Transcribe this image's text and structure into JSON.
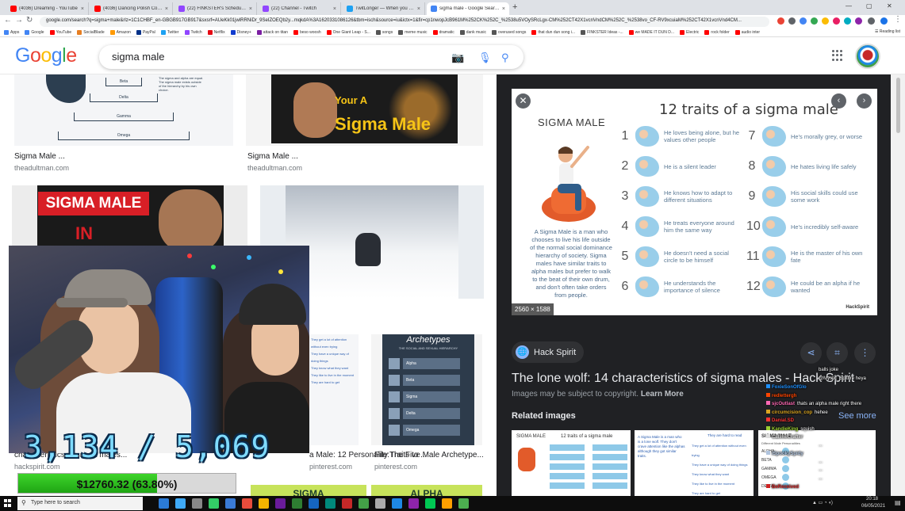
{
  "browser": {
    "tabs": [
      {
        "title": "(4036) Dreaming - YouTube",
        "color": "#ff0000"
      },
      {
        "title": "(4036) Dancing Polish Cow 10 H",
        "color": "#ff0000"
      },
      {
        "title": "(22) FINKSTER's Schedule - Twi",
        "color": "#9146ff"
      },
      {
        "title": "(22) Channel - Twitch",
        "color": "#9146ff"
      },
      {
        "title": "TwitLonger — When you talk to",
        "color": "#1da1f2"
      },
      {
        "title": "sigma male - Google Search",
        "color": "#4285f4"
      }
    ],
    "url": "google.com/search?q=sigma+male&rlz=1C1CHBF_en-GBGB917GB917&sxsrf=AUeKk01jwlRRNiDr_9SeIZOEQb2y...mqkdA%3A1620331086126&tbm=isch&source=iu&ictx=1&fir=cp1nwopJcB961M%252CK%252C_%2538u5VOySRcLgx-CM%252CT42X1vcnVndCM%252C_%2538vo_CF-RV9xcuiaM%252CT42X1vcnVnd4CM..."
  },
  "bookmarks": [
    {
      "label": "Apps",
      "color": "#4285f4"
    },
    {
      "label": "Google",
      "color": "#4285f4"
    },
    {
      "label": "YouTube",
      "color": "#ff0000"
    },
    {
      "label": "SocialBlade",
      "color": "#e67e22"
    },
    {
      "label": "Amazon",
      "color": "#ff9900"
    },
    {
      "label": "PayPal",
      "color": "#003087"
    },
    {
      "label": "Twitter",
      "color": "#1da1f2"
    },
    {
      "label": "Twitch",
      "color": "#9146ff"
    },
    {
      "label": "Netflix",
      "color": "#e50914"
    },
    {
      "label": "Disney+",
      "color": "#113ccf"
    },
    {
      "label": "attack on titan",
      "color": "#7b1fa2"
    },
    {
      "label": "beso woosh",
      "color": "#ff0000"
    },
    {
      "label": "One Giant Leap - S...",
      "color": "#ff0000"
    },
    {
      "label": "songs",
      "color": "#555555"
    },
    {
      "label": "meme music",
      "color": "#555555"
    },
    {
      "label": "dramatic",
      "color": "#ff0000"
    },
    {
      "label": "dank music",
      "color": "#555555"
    },
    {
      "label": "overused songs",
      "color": "#555555"
    },
    {
      "label": "that dun dun song i...",
      "color": "#ff0000"
    },
    {
      "label": "FINKSTER Ideas -...",
      "color": "#555555"
    },
    {
      "label": "we MADE IT DUN D...",
      "color": "#ff0000"
    },
    {
      "label": "Electric",
      "color": "#ff0000"
    },
    {
      "label": "rock folder",
      "color": "#ff0000"
    },
    {
      "label": "audio inter",
      "color": "#ff0000"
    }
  ],
  "reading_list": "Reading list",
  "search": {
    "query": "sigma male"
  },
  "results": [
    {
      "caption": "Sigma Male ...",
      "source": "theadultman.com"
    },
    {
      "caption": "Sigma Male ...",
      "source": "theadultman.com"
    },
    {
      "caption": "characteristics of sigma males...",
      "source": "hackspirit.com"
    },
    {
      "caption": "a Male: 12 Personality Traits to ...",
      "source": "pinterest.com"
    },
    {
      "caption": "File:The Five Male Archetype...",
      "source": "pinterest.com"
    }
  ],
  "thumb_texts": {
    "pyramid": [
      "Beta",
      "Delta",
      "Gamma",
      "Omega"
    ],
    "pyramid_note": "The sigma and alpha are equal. The sigma male exists outside of the hierarchy by his own choice.",
    "your_a": "Your A",
    "sigma_male": "Sigma Male",
    "sigma_male_caps": "SIGMA MALE",
    "in": "IN",
    "archetypes": "Archetypes",
    "archetypes_sub": "THE SOCIAL AND SEXUAL HIERARCHY",
    "arch_rows": [
      "Alpha",
      "Beta",
      "Sigma",
      "Delta",
      "Omega"
    ],
    "bottom": [
      "SIGMA",
      "ALPHA"
    ]
  },
  "preview": {
    "infographic": {
      "title": "12 traits of a sigma male",
      "subtitle": "SIGMA MALE",
      "description": "A Sigma Male is a man who chooses to live his life outside of the normal social dominance hierarchy of society. Sigma males have similar traits to alpha males but prefer to walk to the beat of their own drum, and don't often take orders from people.",
      "dimensions": "2560 × 1588",
      "logo": "HackSpirit",
      "traits": [
        {
          "n": "1",
          "text": "He loves being alone, but he values other people"
        },
        {
          "n": "2",
          "text": "He is a silent leader"
        },
        {
          "n": "3",
          "text": "He knows how to adapt to different situations"
        },
        {
          "n": "4",
          "text": "He treats everyone around him the same way"
        },
        {
          "n": "5",
          "text": "He doesn't need a social circle to be himself"
        },
        {
          "n": "6",
          "text": "He understands the importance of silence"
        },
        {
          "n": "7",
          "text": "He's morally grey, or worse"
        },
        {
          "n": "8",
          "text": "He hates living life safely"
        },
        {
          "n": "9",
          "text": "His social skills could use some work"
        },
        {
          "n": "10",
          "text": "He's incredibly self-aware"
        },
        {
          "n": "11",
          "text": "He is the master of his own fate"
        },
        {
          "n": "12",
          "text": "He could be an alpha if he wanted"
        }
      ]
    },
    "source_name": "Hack Spirit",
    "title": "The lone wolf: 14 characteristics of sigma males - Hack Spirit",
    "copyright_prefix": "Images may be subject to copyright. ",
    "learn_more": "Learn More",
    "related_heading": "Related images",
    "see_more": "See more",
    "related": [
      {
        "heading": "SIGMA MALE",
        "sub": "12 traits of a sigma male"
      },
      {
        "heading": "A Sigma Male is a man who is a lone wolf. They don't crave attention like the alphas although they got similar traits.",
        "sub": "They are hard to read"
      },
      {
        "heading": "SIGMA MALE",
        "sub": "Different Male Personalities"
      }
    ],
    "related_lines": [
      "They get a lot of attention without even trying",
      "They have a unique way of doing things",
      "They know what they want",
      "They like to live in the moment",
      "They are hard to get"
    ],
    "related3_labels": [
      "ALPHA",
      "BETA",
      "GAMMA",
      "OMEGA",
      "DELTA"
    ]
  },
  "chat": [
    {
      "user": "",
      "text": "balls joke",
      "color": "#ffffff"
    },
    {
      "user": "",
      "text": "@Mystic_Spitfire heya",
      "color": "#ffffff"
    },
    {
      "user": "FoxieSonOfGlo",
      "text": "",
      "color": "#1e90ff"
    },
    {
      "user": "redlettergh",
      "text": "",
      "color": "#ff4500"
    },
    {
      "user": "sjcOutlast",
      "text": "thats an alpha male right there",
      "color": "#ff69b4"
    },
    {
      "user": "circumcision_cop",
      "text": "hehee",
      "color": "#daa520"
    },
    {
      "user": "Danial.SD",
      "text": "",
      "color": "#ff3333"
    },
    {
      "user": "KandieKing",
      "text": "squish",
      "color": "#9acd32"
    },
    {
      "user": "CallmeCrafter",
      "text": "",
      "color": "#dddddd"
    },
    {
      "user": "",
      "text": "...",
      "color": "#ffffff"
    },
    {
      "user": "iSpookySpidy",
      "text": "",
      "color": "#b0c4de"
    },
    {
      "user": "",
      "text": "...",
      "color": "#ffffff"
    },
    {
      "user": "",
      "text": "...",
      "color": "#ffffff"
    },
    {
      "user": "",
      "text": "...",
      "color": "#ffffff"
    },
    {
      "user": "BeReceived",
      "text": "",
      "color": "#cc2222"
    }
  ],
  "overlay": {
    "sub_count": "3,134 / 5,069",
    "goal_text": "$12760.32 (63.80%)",
    "goal_fraction": 0.638
  },
  "taskbar": {
    "search_placeholder": "Type here to search",
    "time": "20:18",
    "date": "06/05/2021",
    "icons": [
      "#2b7bd6",
      "#3fa9f5",
      "#888888",
      "#33cc66",
      "#3a7bd5",
      "#e74c3c",
      "#f4b400",
      "#6a1b9a",
      "#2e7d32",
      "#1565c0",
      "#00897b",
      "#c62828",
      "#43a047",
      "#aaaaaa",
      "#1e88e5",
      "#8e24aa",
      "#00c853",
      "#ffa000",
      "#4caf50"
    ]
  }
}
